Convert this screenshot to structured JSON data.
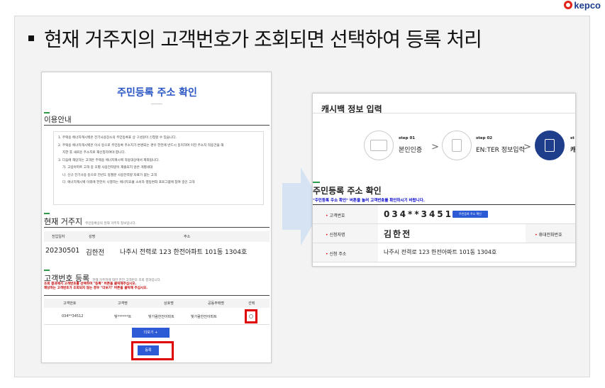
{
  "brand": {
    "logo_text": "kepco"
  },
  "headline": "현재 거주지의 고객번호가 조회되면 선택하여 등록 처리",
  "left_panel": {
    "title": "주민등록 주소 확인",
    "notice_heading": "이용안내",
    "notices": [
      "1. 주택용 에너지캐시백은 전기사용장소의 주민등록표 상 구성원이 신청할 수 있습니다.",
      "2. 주택용 에너지캐시백은 이사 등으로 주민등록 주소지가 변경되는 경우 한전에 반드시 등지하여 이전 주소지 적용건을 해",
      "지한 후 새로운 주소지로 재신청하여야 합니다.",
      "3. 다음에 해당하는 고객은 주택용 에너지캐시백 적용대상에서 제외됩니다.",
      "가. 고압아파트 고객 중 호별 사용전력량이 제출되지 않은 개별세대",
      "나. 신규 전기사용 등으로 전년도 동월분 사용전력량 자료가 없는 고객",
      "다. 에너지캐시백 이외에 한전이 시행하는 에너지효율 소비자 행동변화 프로그램에 참여 중인 고객"
    ],
    "residence": {
      "heading": "현재 거주지",
      "sub": "주민등록상의 현재 거주지 정보입니다.",
      "headers": [
        "전입일자",
        "성명",
        "주소"
      ],
      "row": {
        "date": "20230501",
        "name": "김한전",
        "address": "나주시 전력로 123 한전아파트 101동 1304호"
      }
    },
    "customer": {
      "heading": "고객번호 등록",
      "sub": "현재 거주지에 대한 한전 고객번호 조회 결과입니다.",
      "warn1": "조회 결과에서 고객번호를 선택하여 \"등록\" 버튼을 클릭해주십시오.",
      "warn2": "해당하는 고객번호가 조회되지 않는 경우 \"더보기\" 버튼을 클릭해 주십시오.",
      "headers": [
        "고객번호",
        "고객명",
        "상호명",
        "공동주택명",
        "선택"
      ],
      "row": {
        "number": "034**34512",
        "name": "빛******트",
        "shop": "빛가람한전아파트",
        "apt": "빛가람한전아파트"
      },
      "more_label": "더보기 +",
      "register_label": "등록"
    }
  },
  "right_panel": {
    "title": "캐시백 정보 입력",
    "steps": [
      {
        "num": "step 01",
        "label": "본인인증"
      },
      {
        "num": "step 02",
        "label": "EN:TER 정보입력"
      },
      {
        "num": "st",
        "label": "캐"
      }
    ],
    "section_title": "주민등록 주소 확인",
    "instruction": "\"주민등록 주소 확인\" 버튼을 눌러 고객번호를 확인하시기 바랍니다.",
    "rows": {
      "cust_label": "고객번호",
      "cust_value": "034**34512",
      "cust_button": "주민등록 주소 확인",
      "name_label": "신청자명",
      "name_value": "김한전",
      "phone_label": "휴대전화번호",
      "addr_label": "신청 주소",
      "addr_value": "나주시 전력로 123 한전아파트 101동 1304호"
    }
  }
}
